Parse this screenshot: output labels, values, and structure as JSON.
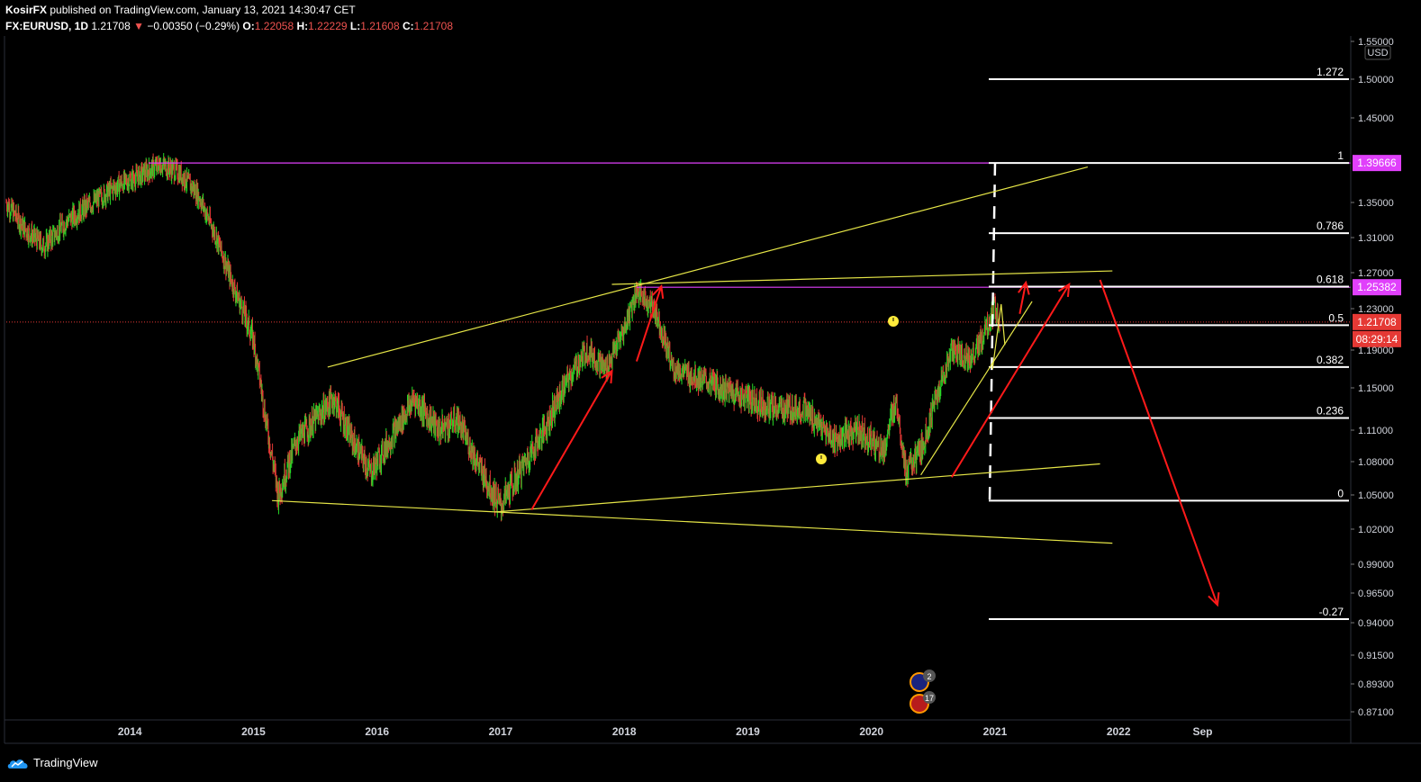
{
  "header": {
    "author": "KosirFX",
    "published": "published on TradingView.com, January 13, 2021 14:30:47 CET",
    "symbol": "FX:EURUSD, 1D",
    "last": "1.21708",
    "change": "−0.00350 (−0.29%)",
    "o_label": "O:",
    "o_value": "1.22058",
    "h_label": "H:",
    "h_value": "1.22229",
    "l_label": "L:",
    "l_value": "1.21608",
    "c_label": "C:",
    "c_value": "1.21708"
  },
  "footer": {
    "brand": "TradingView"
  },
  "colors": {
    "background": "#000000",
    "candle_up": "#26d926",
    "candle_down": "#e53935",
    "trendline": "#e5e547",
    "arrow": "#ff1a1a",
    "magenta": "#e040fb",
    "fib": "#ffffff",
    "price_badge": "#e53935"
  },
  "chart_data": {
    "type": "candlestick",
    "title": "FX:EURUSD, 1D",
    "currency": "USD",
    "x_ticks": [
      "2014",
      "2015",
      "2016",
      "2017",
      "2018",
      "2019",
      "2020",
      "2021",
      "2022",
      "Sep"
    ],
    "y_ticks": [
      "1.55000",
      "1.50000",
      "1.45000",
      "1.35000",
      "1.31000",
      "1.27000",
      "1.23000",
      "1.19000",
      "1.15000",
      "1.11000",
      "1.08000",
      "1.05000",
      "1.02000",
      "0.99000",
      "0.96500",
      "0.94000",
      "0.91500",
      "0.89300",
      "0.87100"
    ],
    "ylim": [
      0.86,
      1.56
    ],
    "price_path": [
      {
        "t": 2013.0,
        "p": 1.35
      },
      {
        "t": 2013.15,
        "p": 1.32
      },
      {
        "t": 2013.3,
        "p": 1.3
      },
      {
        "t": 2013.5,
        "p": 1.33
      },
      {
        "t": 2013.7,
        "p": 1.35
      },
      {
        "t": 2013.9,
        "p": 1.37
      },
      {
        "t": 2014.05,
        "p": 1.38
      },
      {
        "t": 2014.25,
        "p": 1.395
      },
      {
        "t": 2014.4,
        "p": 1.385
      },
      {
        "t": 2014.55,
        "p": 1.36
      },
      {
        "t": 2014.7,
        "p": 1.31
      },
      {
        "t": 2014.85,
        "p": 1.25
      },
      {
        "t": 2015.0,
        "p": 1.2
      },
      {
        "t": 2015.1,
        "p": 1.12
      },
      {
        "t": 2015.2,
        "p": 1.05
      },
      {
        "t": 2015.35,
        "p": 1.1
      },
      {
        "t": 2015.5,
        "p": 1.12
      },
      {
        "t": 2015.65,
        "p": 1.14
      },
      {
        "t": 2015.8,
        "p": 1.1
      },
      {
        "t": 2015.95,
        "p": 1.07
      },
      {
        "t": 2016.1,
        "p": 1.1
      },
      {
        "t": 2016.3,
        "p": 1.14
      },
      {
        "t": 2016.5,
        "p": 1.11
      },
      {
        "t": 2016.65,
        "p": 1.12
      },
      {
        "t": 2016.85,
        "p": 1.07
      },
      {
        "t": 2017.0,
        "p": 1.04
      },
      {
        "t": 2017.15,
        "p": 1.07
      },
      {
        "t": 2017.35,
        "p": 1.11
      },
      {
        "t": 2017.55,
        "p": 1.16
      },
      {
        "t": 2017.7,
        "p": 1.19
      },
      {
        "t": 2017.85,
        "p": 1.17
      },
      {
        "t": 2018.0,
        "p": 1.21
      },
      {
        "t": 2018.1,
        "p": 1.25
      },
      {
        "t": 2018.25,
        "p": 1.23
      },
      {
        "t": 2018.4,
        "p": 1.17
      },
      {
        "t": 2018.6,
        "p": 1.16
      },
      {
        "t": 2018.8,
        "p": 1.15
      },
      {
        "t": 2019.0,
        "p": 1.14
      },
      {
        "t": 2019.2,
        "p": 1.13
      },
      {
        "t": 2019.45,
        "p": 1.13
      },
      {
        "t": 2019.7,
        "p": 1.1
      },
      {
        "t": 2019.9,
        "p": 1.11
      },
      {
        "t": 2020.1,
        "p": 1.09
      },
      {
        "t": 2020.2,
        "p": 1.14
      },
      {
        "t": 2020.28,
        "p": 1.07
      },
      {
        "t": 2020.4,
        "p": 1.09
      },
      {
        "t": 2020.55,
        "p": 1.15
      },
      {
        "t": 2020.65,
        "p": 1.19
      },
      {
        "t": 2020.8,
        "p": 1.18
      },
      {
        "t": 2020.9,
        "p": 1.2
      },
      {
        "t": 2021.0,
        "p": 1.23
      },
      {
        "t": 2021.04,
        "p": 1.217
      }
    ],
    "fibonacci": [
      {
        "level": "1.272",
        "price": 1.5
      },
      {
        "level": "1",
        "price": 1.39666
      },
      {
        "level": "0.786",
        "price": 1.315
      },
      {
        "level": "0.618",
        "price": 1.2545
      },
      {
        "level": "0.5",
        "price": 1.214
      },
      {
        "level": "0.382",
        "price": 1.172
      },
      {
        "level": "0.236",
        "price": 1.1215
      },
      {
        "level": "0",
        "price": 1.045
      },
      {
        "level": "-0.27",
        "price": 0.943
      }
    ],
    "horizontal_levels": [
      {
        "label": "1.39666",
        "price": 1.39666
      },
      {
        "label": "1.25382",
        "price": 1.25382
      }
    ],
    "current_price": {
      "label": "1.21708",
      "price": 1.21708,
      "countdown": "08:29:14"
    },
    "trendlines": [
      {
        "from": {
          "t": 2015.6,
          "p": 1.172
        },
        "to": {
          "t": 2021.75,
          "p": 1.392
        }
      },
      {
        "from": {
          "t": 2017.9,
          "p": 1.257
        },
        "to": {
          "t": 2021.95,
          "p": 1.272
        }
      },
      {
        "from": {
          "t": 2015.15,
          "p": 1.045
        },
        "to": {
          "t": 2021.95,
          "p": 1.008
        }
      },
      {
        "from": {
          "t": 2016.95,
          "p": 1.035
        },
        "to": {
          "t": 2021.85,
          "p": 1.078
        }
      },
      {
        "from": {
          "t": 2020.4,
          "p": 1.068
        },
        "to": {
          "t": 2021.3,
          "p": 1.238
        }
      }
    ],
    "arrows": [
      {
        "from": {
          "t": 2017.25,
          "p": 1.037
        },
        "to": {
          "t": 2017.9,
          "p": 1.168
        }
      },
      {
        "from": {
          "t": 2018.1,
          "p": 1.178
        },
        "to": {
          "t": 2018.3,
          "p": 1.255
        }
      },
      {
        "from": {
          "t": 2020.65,
          "p": 1.066
        },
        "to": {
          "t": 2021.6,
          "p": 1.257
        }
      },
      {
        "from": {
          "t": 2021.85,
          "p": 1.262
        },
        "to": {
          "t": 2022.8,
          "p": 0.955
        }
      },
      {
        "from": {
          "t": 2021.2,
          "p": 1.225
        },
        "to": {
          "t": 2021.25,
          "p": 1.259
        }
      }
    ],
    "event_badges": [
      {
        "flag": "EU",
        "count": "2"
      },
      {
        "flag": "US",
        "count": "17"
      }
    ],
    "grid": false,
    "legend": "none"
  }
}
